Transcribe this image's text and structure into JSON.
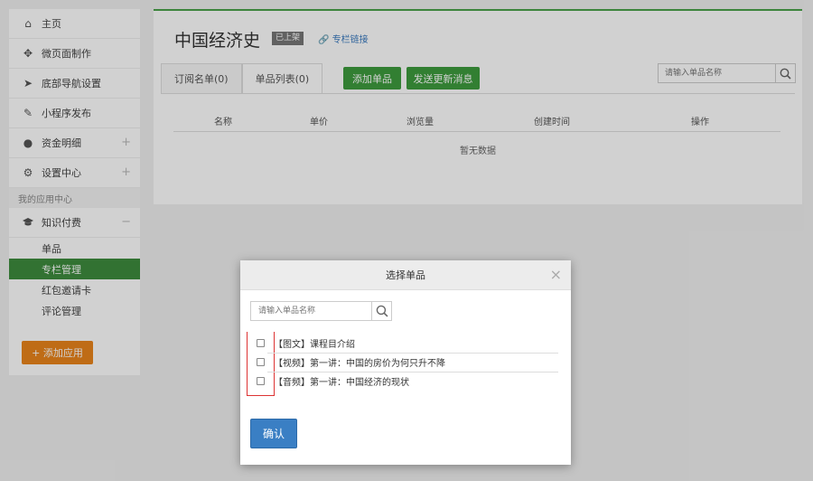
{
  "sidebar": {
    "items": [
      {
        "label": "主页",
        "icon": "home-icon",
        "glyph": "⌂",
        "plus": ""
      },
      {
        "label": "微页面制作",
        "icon": "puzzle-icon",
        "glyph": "✥",
        "plus": ""
      },
      {
        "label": "底部导航设置",
        "icon": "navigation-icon",
        "glyph": "➤",
        "plus": ""
      },
      {
        "label": "小程序发布",
        "icon": "edit-icon",
        "glyph": "✎",
        "plus": ""
      },
      {
        "label": "资金明细",
        "icon": "money-bag-icon",
        "glyph": "●",
        "plus": "+"
      },
      {
        "label": "设置中心",
        "icon": "gear-icon",
        "glyph": "⚙",
        "plus": "+"
      }
    ],
    "section": "我的应用中心",
    "app": {
      "label": "知识付费",
      "icon": "graduation-cap-icon",
      "glyph": "🎓",
      "toggle": "−"
    },
    "sub_items": [
      {
        "label": "单品"
      },
      {
        "label": "专栏管理"
      },
      {
        "label": "红包邀请卡"
      },
      {
        "label": "评论管理"
      }
    ],
    "add_app": "+ 添加应用"
  },
  "main": {
    "title": "中国经济史",
    "badge": "已上架",
    "qr_link": "专栏链接",
    "tabs": [
      "订阅名单(0)",
      "单品列表(0)"
    ],
    "add_item_button": "添加单品",
    "send_update_button": "发送更新消息",
    "search_placeholder": "请输入单品名称",
    "columns": [
      "名称",
      "单价",
      "浏览量",
      "创建时间",
      "操作"
    ],
    "empty": "暂无数据"
  },
  "modal": {
    "title": "选择单品",
    "close": "×",
    "search_placeholder": "请输入单品名称",
    "items": [
      "【图文】课程目介绍",
      "【视频】第一讲：中国的房价为何只升不降",
      "【音频】第一讲：中国经济的现状"
    ],
    "confirm": "确认"
  },
  "colors": {
    "green": "#3d9b3d",
    "orange": "#e9841b",
    "blue": "#3a7fc4",
    "red_box": "#dd3333"
  }
}
